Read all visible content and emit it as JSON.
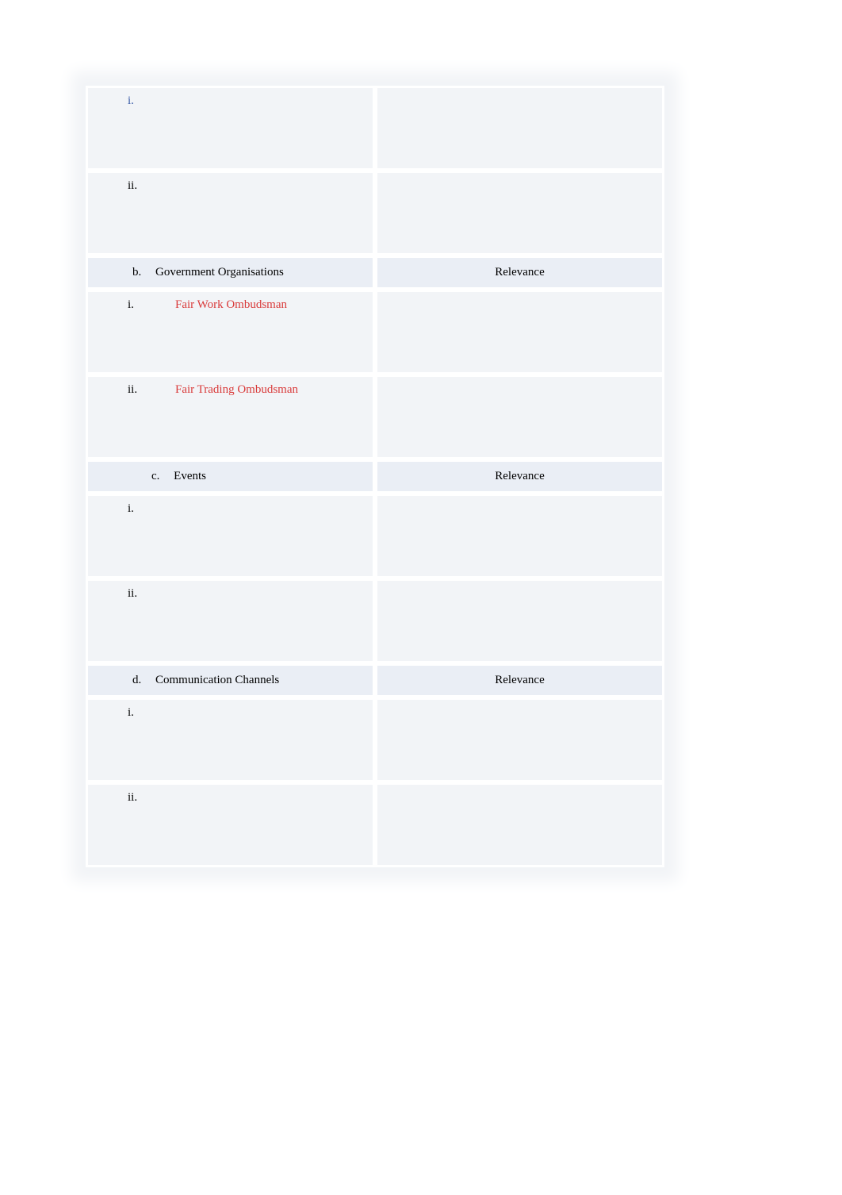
{
  "sections": [
    {
      "type": "items",
      "rows": [
        {
          "numeral": "i.",
          "numeralStyle": "blue",
          "text": "",
          "relevance": ""
        },
        {
          "numeral": "ii.",
          "numeralStyle": "normal",
          "text": "",
          "relevance": ""
        }
      ]
    },
    {
      "type": "header",
      "letter": "b.",
      "title": "Government Organisations",
      "relevanceLabel": "Relevance"
    },
    {
      "type": "items",
      "rows": [
        {
          "numeral": "i.",
          "numeralStyle": "normal",
          "text": "Fair Work Ombudsman",
          "textStyle": "red",
          "relevance": ""
        },
        {
          "numeral": "ii.",
          "numeralStyle": "normal",
          "text": "Fair Trading Ombudsman",
          "textStyle": "red",
          "relevance": ""
        }
      ]
    },
    {
      "type": "header",
      "letter": "c.",
      "title": "Events",
      "relevanceLabel": "Relevance"
    },
    {
      "type": "items",
      "rows": [
        {
          "numeral": "i.",
          "numeralStyle": "normal",
          "text": "",
          "relevance": ""
        },
        {
          "numeral": "ii.",
          "numeralStyle": "normal",
          "text": "",
          "relevance": ""
        }
      ]
    },
    {
      "type": "header",
      "letter": "d.",
      "title": "Communication Channels",
      "relevanceLabel": "Relevance"
    },
    {
      "type": "items",
      "rows": [
        {
          "numeral": "i.",
          "numeralStyle": "normal",
          "text": "",
          "relevance": ""
        },
        {
          "numeral": "ii.",
          "numeralStyle": "normal",
          "text": "",
          "relevance": ""
        }
      ]
    }
  ]
}
